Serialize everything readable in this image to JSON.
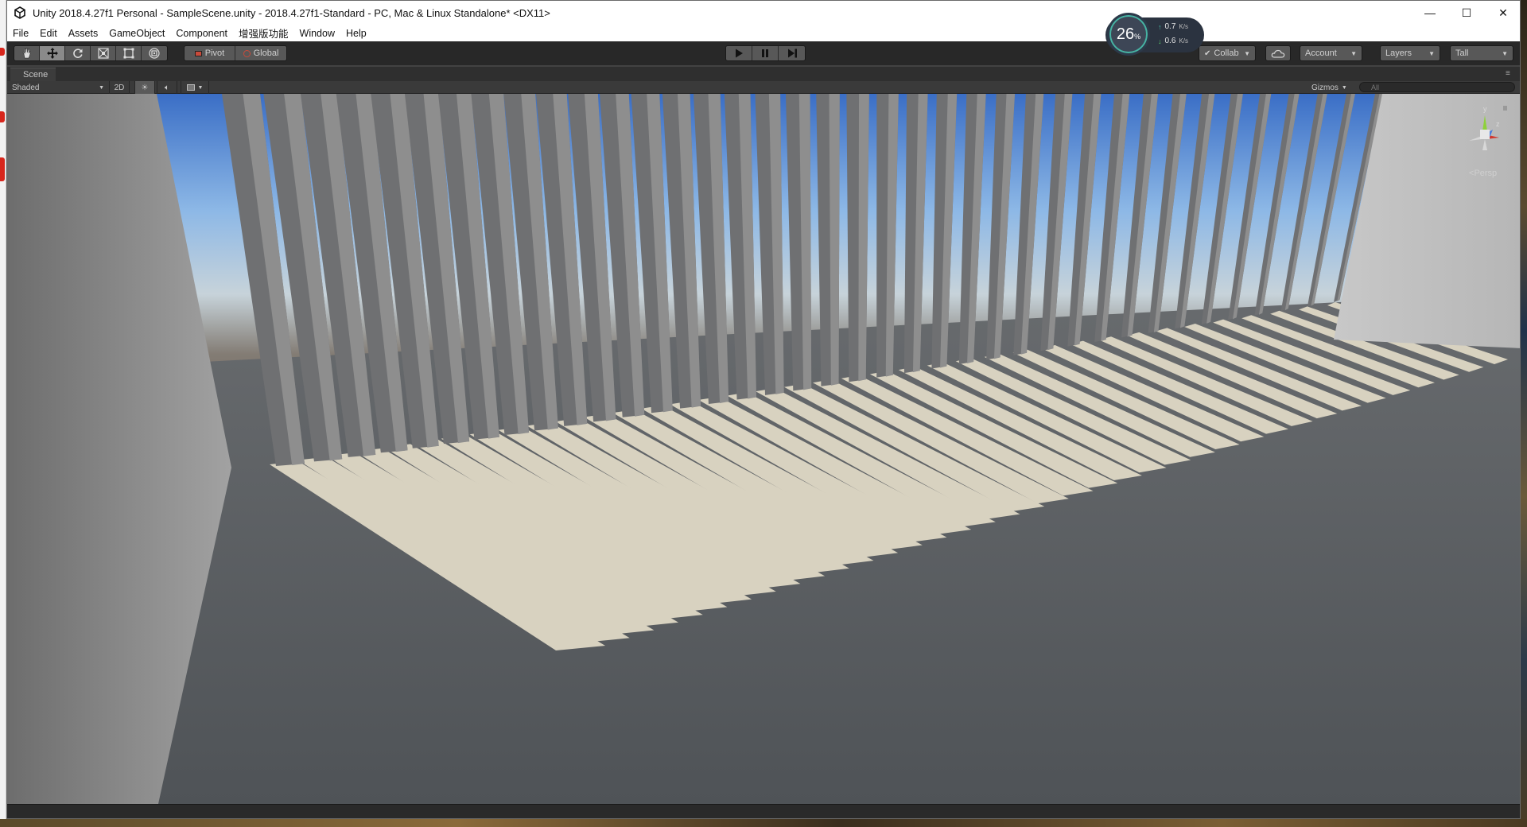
{
  "window": {
    "title": "Unity 2018.4.27f1 Personal - SampleScene.unity - 2018.4.27f1-Standard - PC, Mac & Linux Standalone* <DX11>",
    "minimize": "—",
    "maximize": "☐",
    "close": "✕"
  },
  "menu": [
    "File",
    "Edit",
    "Assets",
    "GameObject",
    "Component",
    "增强版功能",
    "Window",
    "Help"
  ],
  "toolbar": {
    "pivot": "Pivot",
    "global": "Global",
    "collab": "Collab",
    "account": "Account",
    "layers": "Layers",
    "layout": "Tall"
  },
  "perf": {
    "percent": "26",
    "percent_unit": "%",
    "upload": "0.7",
    "download": "0.6",
    "unit": "K/s",
    "ring_fraction": 0.26
  },
  "scene": {
    "tab_label": "Scene",
    "shading": "Shaded",
    "mode_2d": "2D",
    "gizmos": "Gizmos",
    "search_placeholder": "All",
    "projection": "Persp",
    "axis_y": "y",
    "axis_z": "z"
  }
}
